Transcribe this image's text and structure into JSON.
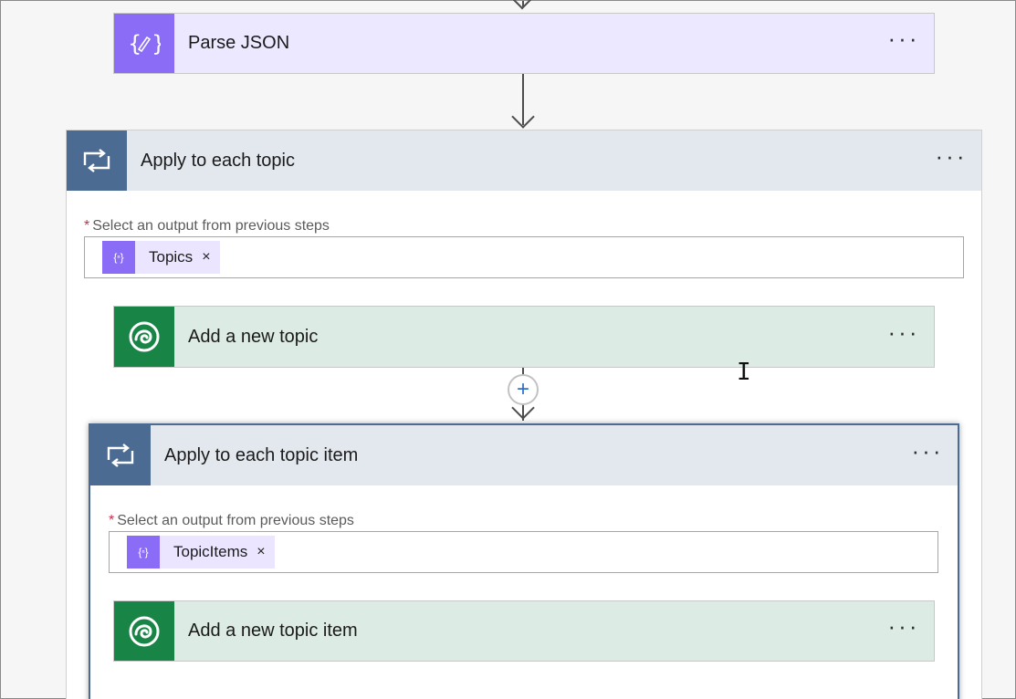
{
  "parse_json": {
    "title": "Parse JSON",
    "more": "···",
    "icon": "json-braces-icon"
  },
  "outer_loop": {
    "title": "Apply to each topic",
    "more": "···",
    "icon": "loop-icon",
    "field_required": "*",
    "field_label": "Select an output from previous steps",
    "token": {
      "label": "Topics",
      "icon": "json-braces-icon",
      "remove": "×"
    }
  },
  "add_topic": {
    "title": "Add a new topic",
    "more": "···",
    "icon": "dataverse-icon"
  },
  "insert_step": {
    "symbol": "+"
  },
  "inner_loop": {
    "title": "Apply to each topic item",
    "more": "···",
    "icon": "loop-icon",
    "field_required": "*",
    "field_label": "Select an output from previous steps",
    "token": {
      "label": "TopicItems",
      "icon": "json-braces-icon",
      "remove": "×"
    }
  },
  "add_topic_item": {
    "title": "Add a new topic item",
    "more": "···",
    "icon": "dataverse-icon"
  },
  "colors": {
    "parse_json_accent": "#8a6cf7",
    "dataverse_accent": "#188446",
    "loop_accent": "#4b6b93",
    "required_marker": "#c4314b"
  }
}
